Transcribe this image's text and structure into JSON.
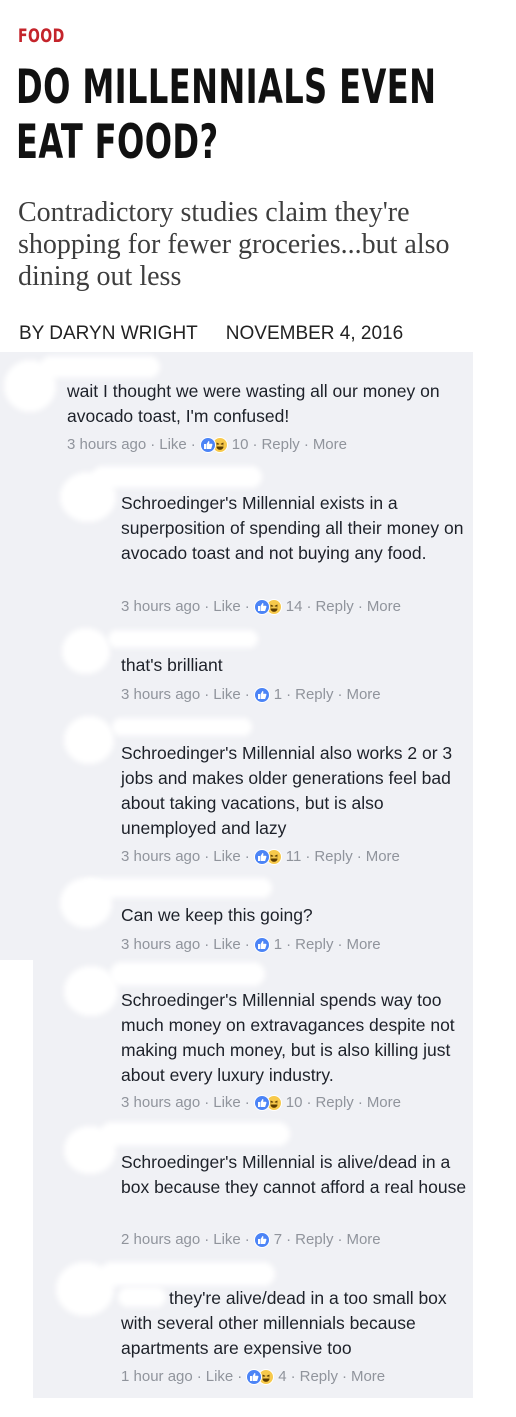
{
  "article": {
    "category": "FOOD",
    "headline_line1": "DO MILLENNIALS EVEN",
    "headline_line2": "EAT FOOD?",
    "subhead": "Contradictory studies claim they're shopping for fewer groceries...but also dining out less",
    "author": "BY DARYN WRIGHT",
    "date": "NOVEMBER 4, 2016"
  },
  "labels": {
    "like": "Like",
    "reply": "Reply",
    "more": "More",
    "sep": "·"
  },
  "comments": [
    {
      "text": "wait I thought we were wasting all our money on avocado toast, I'm confused!",
      "time": "3 hours ago",
      "reactions": [
        "like",
        "haha"
      ],
      "count": "10"
    },
    {
      "text": "Schroedinger's Millennial exists in a superposition of spending all their money on avocado toast and not buying any food.",
      "time": "3 hours ago",
      "reactions": [
        "like",
        "haha"
      ],
      "count": "14"
    },
    {
      "text": "that's brilliant",
      "time": "3 hours ago",
      "reactions": [
        "like"
      ],
      "count": "1"
    },
    {
      "text": "Schroedinger's Millennial also works 2 or 3 jobs and makes older generations feel bad about taking vacations, but is also unemployed and lazy",
      "time": "3 hours ago",
      "reactions": [
        "like",
        "haha"
      ],
      "count": "11"
    },
    {
      "text": "Can we keep this going?",
      "time": "3 hours ago",
      "reactions": [
        "like"
      ],
      "count": "1"
    },
    {
      "text": "Schroedinger's Millennial spends way too much money on extravagances despite not making much money, but is also killing just about every luxury industry.",
      "time": "3 hours ago",
      "reactions": [
        "like",
        "haha"
      ],
      "count": "10"
    },
    {
      "text": "Schroedinger's Millennial is alive/dead in a box because they cannot afford a real house",
      "time": "2 hours ago",
      "reactions": [
        "like"
      ],
      "count": "7"
    },
    {
      "text": "they're alive/dead in a too small box with several other millennials because apartments are expensive too",
      "time": "1 hour ago",
      "reactions": [
        "like",
        "haha"
      ],
      "count": "4"
    }
  ]
}
